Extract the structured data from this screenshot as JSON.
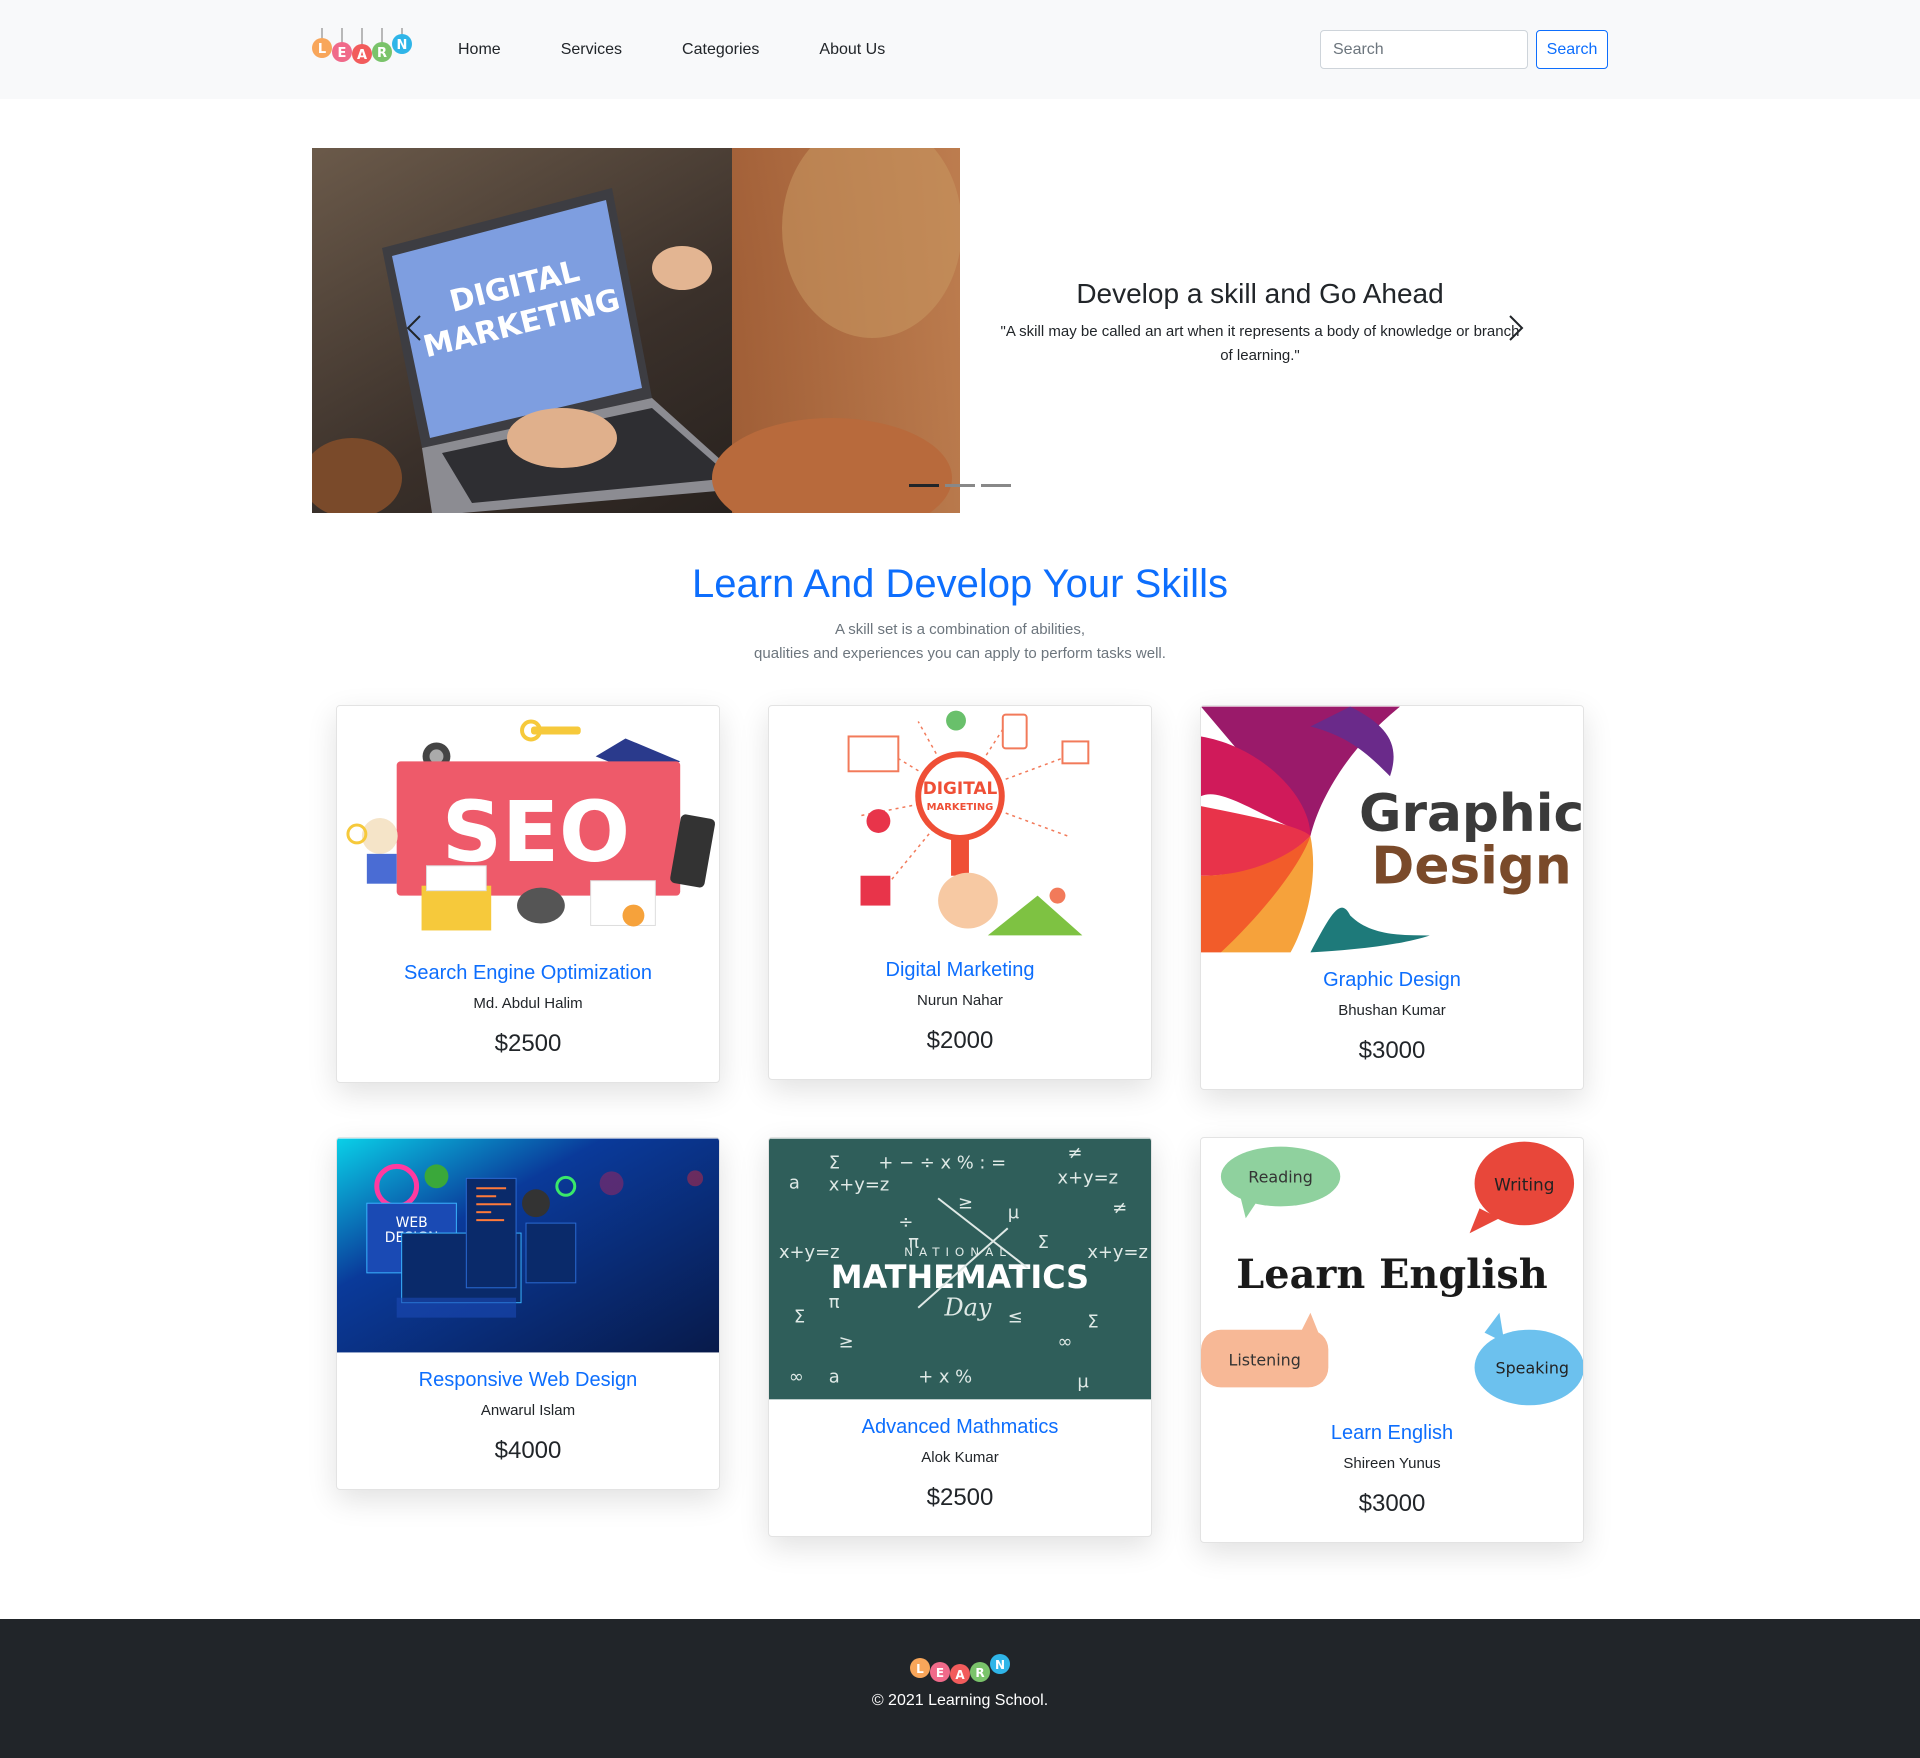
{
  "nav": {
    "logo_text": "LEARN",
    "links": [
      "Home",
      "Services",
      "Categories",
      "About Us"
    ],
    "search_placeholder": "Search",
    "search_button": "Search"
  },
  "hero": {
    "image_text_line1": "DIGITAL",
    "image_text_line2": "MARKETING",
    "title": "Develop a skill and Go Ahead",
    "quote": "\"A skill may be called an art when it represents a body of knowledge or branch of learning.\"",
    "active_slide": 1,
    "slide_count": 3
  },
  "section": {
    "title": "Learn And Develop Your Skills",
    "subtitle_line1": "A skill set is a combination of abilities,",
    "subtitle_line2": "qualities and experiences you can apply to perform tasks well."
  },
  "courses": [
    {
      "title": "Search Engine Optimization",
      "author": "Md. Abdul Halim",
      "price": "$2500",
      "image_text": "SEO"
    },
    {
      "title": "Digital Marketing",
      "author": "Nurun Nahar",
      "price": "$2000",
      "image_text": "DIGITAL MARKETING"
    },
    {
      "title": "Graphic Design",
      "author": "Bhushan Kumar",
      "price": "$3000",
      "image_text": "Graphic Design"
    },
    {
      "title": "Responsive Web Design",
      "author": "Anwarul Islam",
      "price": "$4000",
      "image_text": "WEB DESIGN"
    },
    {
      "title": "Advanced Mathmatics",
      "author": "Alok Kumar",
      "price": "$2500",
      "image_text": "MATHEMATICS"
    },
    {
      "title": "Learn English",
      "author": "Shireen Yunus",
      "price": "$3000",
      "image_text": "Learn English",
      "image_bubbles": [
        "Reading",
        "Writing",
        "Listening",
        "Speaking"
      ]
    }
  ],
  "footer": {
    "copyright": "© 2021 Learning School."
  },
  "colors": {
    "primary": "#0d6efd",
    "navbar_bg": "#f8f9fa",
    "footer_bg": "#212529"
  }
}
